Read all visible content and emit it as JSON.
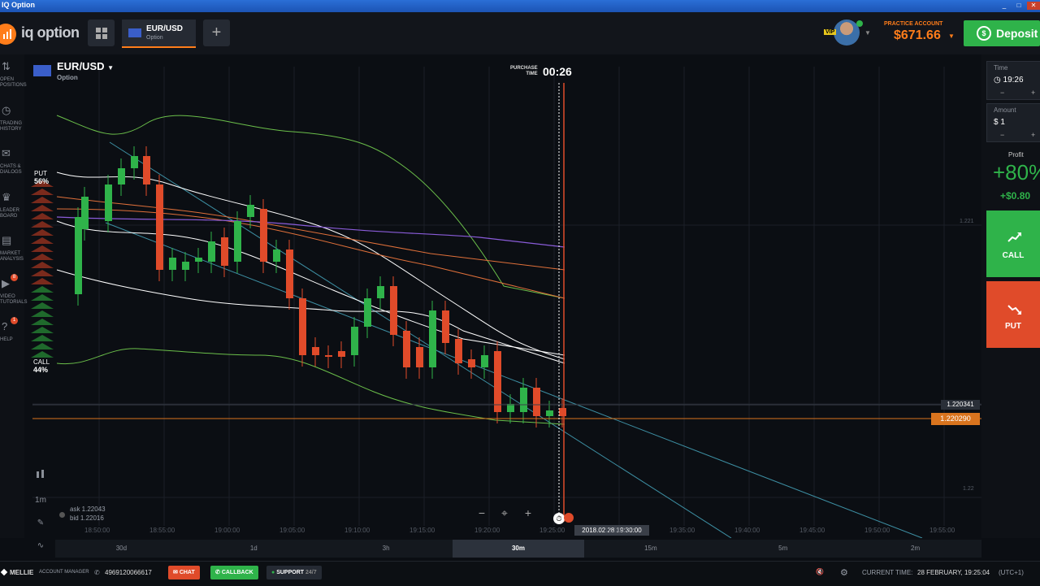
{
  "window": {
    "title": "IQ Option",
    "controls": [
      "_",
      "□",
      "✕"
    ]
  },
  "brand": {
    "name": "iq option",
    "accent": "#ff7d1a"
  },
  "tab": {
    "asset": "EUR/USD",
    "type": "Option"
  },
  "account": {
    "label": "PRACTICE ACCOUNT",
    "balance": "$671.66",
    "vip": "VIP"
  },
  "deposit": {
    "label": "Deposit"
  },
  "sidebar": {
    "items": [
      {
        "icon": "open-positions-icon",
        "label1": "OPEN",
        "label2": "POSITIONS"
      },
      {
        "icon": "trading-history-icon",
        "label1": "TRADING",
        "label2": "HISTORY"
      },
      {
        "icon": "chats-icon",
        "label1": "CHATS &",
        "label2": "DIALOGS"
      },
      {
        "icon": "leaderboard-icon",
        "label1": "LEADER",
        "label2": "BOARD"
      },
      {
        "icon": "market-analysis-icon",
        "label1": "MARKET",
        "label2": "ANALYSIS"
      },
      {
        "icon": "video-tutorials-icon",
        "label1": "VIDEO",
        "label2": "TUTORIALS",
        "badge": "8"
      },
      {
        "icon": "help-icon",
        "label1": "HELP",
        "label2": "",
        "badge": "1"
      }
    ]
  },
  "chart": {
    "asset": "EUR/USD",
    "type": "Option",
    "purchase_label_1": "PURCHASE",
    "purchase_label_2": "TIME",
    "purchase_time": "00:26",
    "put_label": "PUT",
    "put_pct": "56%",
    "call_label": "CALL",
    "call_pct": "44%",
    "price_levels": [
      "1.221",
      "1.22"
    ],
    "ask": "ask 1.22043",
    "bid": "bid 1.22016",
    "price_tag_top": "1.220341",
    "price_tag_current": "1.220290",
    "expiry_tag": "2018.02.28 19:30:00",
    "x_ticks": [
      "18:50:00",
      "18:55:00",
      "19:00:00",
      "19:05:00",
      "19:10:00",
      "19:15:00",
      "19:20:00",
      "19:25:00",
      "19:30:00",
      "19:35:00",
      "19:40:00",
      "19:45:00",
      "19:50:00",
      "19:55:00"
    ],
    "timeframe": "1m",
    "controls": [
      "−",
      "⌖",
      "+"
    ]
  },
  "periods": [
    {
      "label": "30d",
      "selected": false
    },
    {
      "label": "1d",
      "selected": false
    },
    {
      "label": "3h",
      "selected": false
    },
    {
      "label": "30m",
      "selected": true
    },
    {
      "label": "15m",
      "selected": false
    },
    {
      "label": "5m",
      "selected": false
    },
    {
      "label": "2m",
      "selected": false
    }
  ],
  "trade": {
    "time_label": "Time",
    "time_value": "19:26",
    "amount_label": "Amount",
    "amount_currency": "$",
    "amount_value": "1",
    "profit_label": "Profit",
    "profit_pct": "+80%",
    "profit_amount": "+$0.80",
    "call_label": "CALL",
    "put_label": "PUT",
    "call_color": "#2fb34a",
    "put_color": "#e04b2a"
  },
  "bottom": {
    "user": "MELLIE",
    "manager_label": "ACCOUNT MANAGER",
    "phone": "4969120066617",
    "chat": "CHAT",
    "callback": "CALLBACK",
    "support": "SUPPORT",
    "support_hours": "24/7",
    "current_time_label": "CURRENT TIME:",
    "current_time": "28 FEBRUARY, 19:25:04",
    "timezone": "(UTC+1)"
  }
}
